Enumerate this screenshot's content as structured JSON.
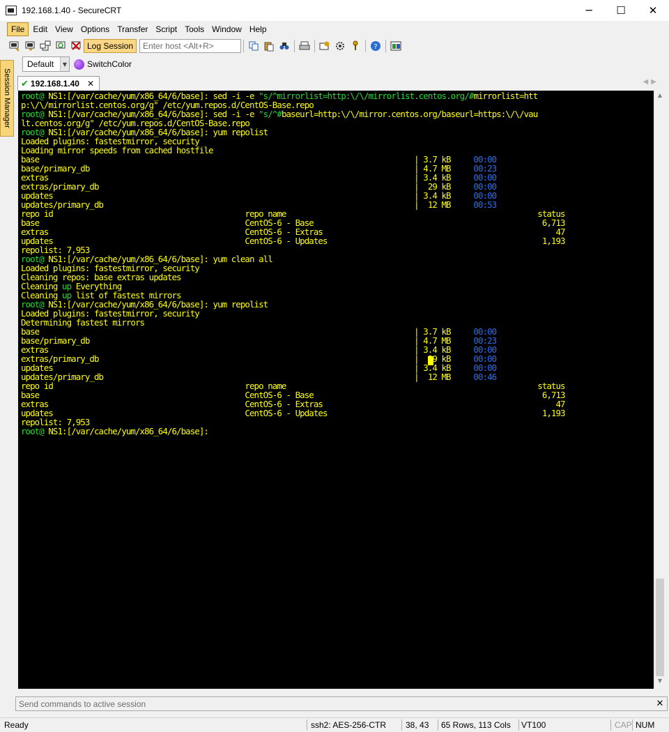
{
  "window": {
    "title": "192.168.1.40 - SecureCRT",
    "minimize": "─",
    "maximize": "☐",
    "close": "✕"
  },
  "menu": [
    "File",
    "Edit",
    "View",
    "Options",
    "Transfer",
    "Script",
    "Tools",
    "Window",
    "Help"
  ],
  "toolbar": {
    "log_session": "Log Session",
    "host_placeholder": "Enter host <Alt+R>"
  },
  "buttonbar": {
    "default_label": "Default",
    "switchcolor_label": "SwitchColor"
  },
  "session_manager": "Session Manager",
  "tab": {
    "label": "192.168.1.40",
    "close": "✕"
  },
  "colors": {
    "prompt": "#22dd33",
    "output": "#ffff00",
    "time": "#2c6ef0",
    "tab_highlight": "#f7d67a"
  },
  "terminal_lines": [
    [
      [
        "g",
        "root@ "
      ],
      [
        "y",
        "NS1:[/var/cache/yum/x86_64/6/base]: sed -i -e "
      ],
      [
        "g",
        "\"s/^mirrorlist=http:\\/\\/mirrorlist.centos.org/#"
      ],
      [
        "y",
        "mirrorlist=htt"
      ]
    ],
    [
      [
        "y",
        "p:\\/\\/mirrorlist.centos.org/g\" /etc/yum.repos.d/CentOS-Base.repo"
      ]
    ],
    [
      [
        "g",
        "root@ "
      ],
      [
        "y",
        "NS1:[/var/cache/yum/x86_64/6/base]: sed -i -e "
      ],
      [
        "g",
        "\"s/^#"
      ],
      [
        "y",
        "baseurl=http:\\/\\/mirror.centos.org/baseurl=https:\\/\\/vau"
      ]
    ],
    [
      [
        "y",
        "lt.centos.org/g\" /etc/yum.repos.d/CentOS-Base.repo"
      ]
    ],
    [
      [
        "g",
        "root@ "
      ],
      [
        "y",
        "NS1:[/var/cache/yum/x86_64/6/base]: yum repolist"
      ]
    ],
    [
      [
        "y",
        "Loaded plugins: fastestmirror, security"
      ]
    ],
    [
      [
        "y",
        "Loading mirror speeds from cached hostfile"
      ]
    ],
    [
      [
        "y",
        "base                                                                                  | 3.7 kB     "
      ],
      [
        "b",
        "00:00"
      ]
    ],
    [
      [
        "y",
        "base/primary_db                                                                       | 4.7 MB     "
      ],
      [
        "b",
        "00:23"
      ]
    ],
    [
      [
        "y",
        "extras                                                                                | 3.4 kB     "
      ],
      [
        "b",
        "00:00"
      ]
    ],
    [
      [
        "y",
        "extras/primary_db                                                                     |  29 kB     "
      ],
      [
        "b",
        "00:00"
      ]
    ],
    [
      [
        "y",
        "updates                                                                               | 3.4 kB     "
      ],
      [
        "b",
        "00:00"
      ]
    ],
    [
      [
        "y",
        "updates/primary_db                                                                    |  12 MB     "
      ],
      [
        "b",
        "00:53"
      ]
    ],
    [
      [
        "y",
        "repo id                                          repo name                                                       status"
      ]
    ],
    [
      [
        "y",
        "base                                             CentOS-6 - Base                                                  6,713"
      ]
    ],
    [
      [
        "y",
        "extras                                           CentOS-6 - Extras                                                   47"
      ]
    ],
    [
      [
        "y",
        "updates                                          CentOS-6 - Updates                                               1,193"
      ]
    ],
    [
      [
        "y",
        "repolist: 7,953"
      ]
    ],
    [
      [
        "g",
        "root@ "
      ],
      [
        "y",
        "NS1:[/var/cache/yum/x86_64/6/base]: yum clean all"
      ]
    ],
    [
      [
        "y",
        "Loaded plugins: fastestmirror, security"
      ]
    ],
    [
      [
        "y",
        "Cleaning repos: base extras updates"
      ]
    ],
    [
      [
        "y",
        "Cleaning "
      ],
      [
        "g",
        "up"
      ],
      [
        "y",
        " Everything"
      ]
    ],
    [
      [
        "y",
        "Cleaning "
      ],
      [
        "g",
        "up"
      ],
      [
        "y",
        " list of fastest mirrors"
      ]
    ],
    [
      [
        "g",
        "root@ "
      ],
      [
        "y",
        "NS1:[/var/cache/yum/x86_64/6/base]: yum repolist"
      ]
    ],
    [
      [
        "y",
        "Loaded plugins: fastestmirror, security"
      ]
    ],
    [
      [
        "y",
        "Determining fastest mirrors"
      ]
    ],
    [
      [
        "y",
        "base                                                                                  | 3.7 kB     "
      ],
      [
        "b",
        "00:00"
      ]
    ],
    [
      [
        "y",
        "base/primary_db                                                                       | 4.7 MB     "
      ],
      [
        "b",
        "00:23"
      ]
    ],
    [
      [
        "y",
        "extras                                                                                | 3.4 kB     "
      ],
      [
        "b",
        "00:00"
      ]
    ],
    [
      [
        "y",
        "extras/primary_db                                                                     |  29 kB     "
      ],
      [
        "b",
        "00:00"
      ]
    ],
    [
      [
        "y",
        "updates                                                                               | 3.4 kB     "
      ],
      [
        "b",
        "00:00"
      ]
    ],
    [
      [
        "y",
        "updates/primary_db                                                                    |  12 MB     "
      ],
      [
        "b",
        "00:46"
      ]
    ],
    [
      [
        "y",
        "repo id                                          repo name                                                       status"
      ]
    ],
    [
      [
        "y",
        "base                                             CentOS-6 - Base                                                  6,713"
      ]
    ],
    [
      [
        "y",
        "extras                                           CentOS-6 - Extras                                                   47"
      ]
    ],
    [
      [
        "y",
        "updates                                          CentOS-6 - Updates                                               1,193"
      ]
    ],
    [
      [
        "y",
        "repolist: 7,953"
      ]
    ],
    [
      [
        "g",
        "root@ "
      ],
      [
        "y",
        "NS1:[/var/cache/yum/x86_64/6/base]:"
      ]
    ]
  ],
  "command_window": {
    "placeholder": "Send commands to active session",
    "close": "✕"
  },
  "status": {
    "ready": "Ready",
    "cipher": "ssh2: AES-256-CTR",
    "cursor_pos": "38,  43",
    "size": "65 Rows, 113 Cols",
    "emulation": "VT100",
    "cap": "CAP",
    "num": "NUM"
  }
}
